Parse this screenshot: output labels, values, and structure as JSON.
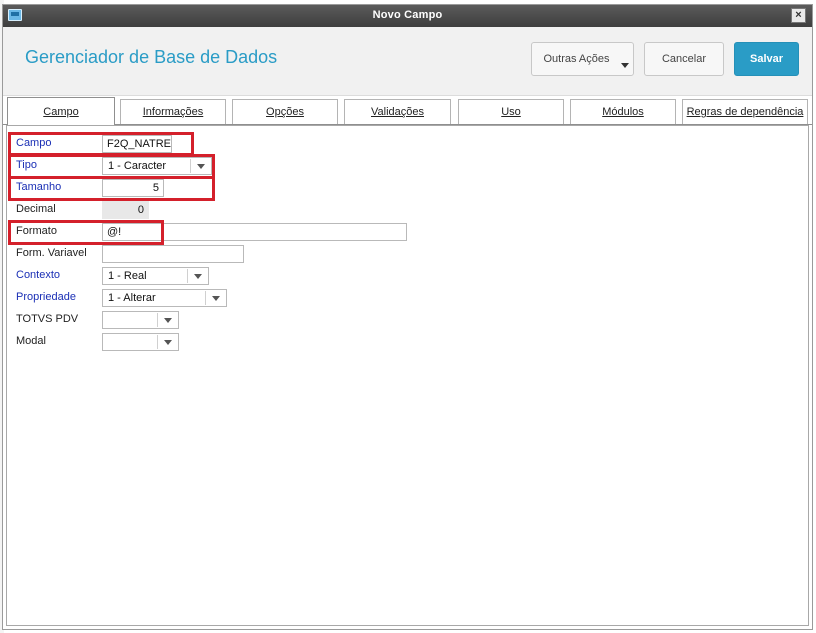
{
  "window": {
    "title": "Novo Campo",
    "close_glyph": "×"
  },
  "header": {
    "app_title": "Gerenciador de Base de Dados",
    "buttons": {
      "outras": "Outras Ações",
      "cancelar": "Cancelar",
      "salvar": "Salvar"
    }
  },
  "tabs": [
    "Campo",
    "Informações",
    "Opções",
    "Validações",
    "Uso",
    "Módulos",
    "Regras de dependência"
  ],
  "active_tab": "Campo",
  "form": {
    "campo": {
      "label": "Campo",
      "value": "F2Q_NATRE"
    },
    "tipo": {
      "label": "Tipo",
      "value": "1 - Caracter"
    },
    "tamanho": {
      "label": "Tamanho",
      "value": "5"
    },
    "decimal": {
      "label": "Decimal",
      "value": "0"
    },
    "formato": {
      "label": "Formato",
      "value": "@!"
    },
    "form_variavel": {
      "label": "Form. Variavel",
      "value": ""
    },
    "contexto": {
      "label": "Contexto",
      "value": "1 - Real"
    },
    "propriedade": {
      "label": "Propriedade",
      "value": "1 - Alterar"
    },
    "totvs_pdv": {
      "label": "TOTVS PDV",
      "value": ""
    },
    "modal": {
      "label": "Modal",
      "value": ""
    }
  },
  "colors": {
    "accent": "#2a9cc6",
    "required_label": "#1a2fb5",
    "highlight": "#d4202b"
  },
  "icons": {
    "window_icon": "app-window-icon",
    "close": "close-icon",
    "dropdown": "chevron-down-icon"
  }
}
